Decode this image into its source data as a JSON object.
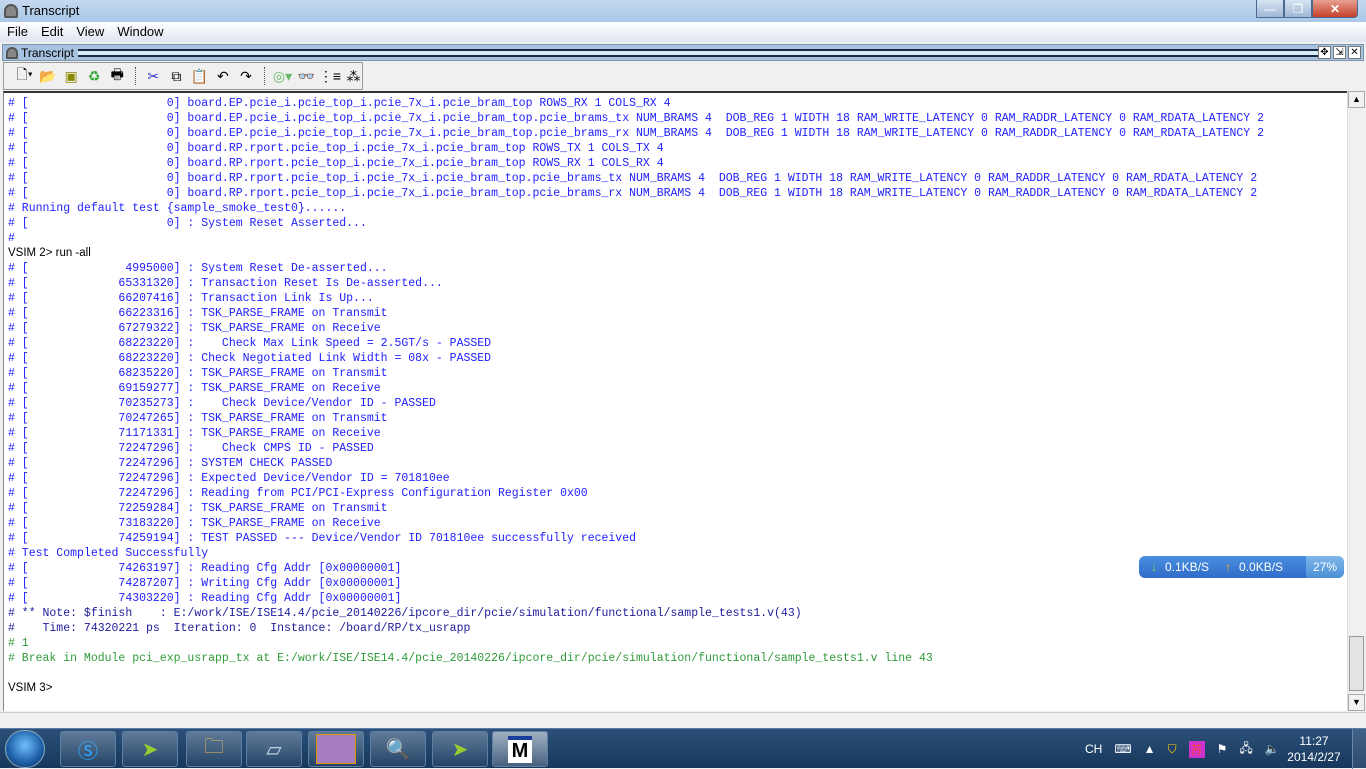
{
  "window": {
    "title": "Transcript",
    "controls": {
      "minimize": "—",
      "maximize": "❐",
      "close": "✕"
    }
  },
  "menu": [
    "File",
    "Edit",
    "View",
    "Window"
  ],
  "panel": {
    "title": "Transcript",
    "buttons": [
      "✥",
      "⇲",
      "✕"
    ]
  },
  "toolbar": {
    "icons": [
      "new-file-icon",
      "open-folder-icon",
      "save-icon",
      "refresh-icon",
      "print-icon",
      "cut-icon",
      "copy-icon",
      "paste-icon",
      "undo-icon",
      "redo-icon",
      "compile-icon",
      "find-icon",
      "collapse-icon",
      "expand-icon"
    ]
  },
  "transcript": {
    "lines": [
      {
        "t": "# [                    0] board.EP.pcie_i.pcie_top_i.pcie_7x_i.pcie_bram_top ROWS_RX 1 COLS_RX 4",
        "c": "blue"
      },
      {
        "t": "# [                    0] board.EP.pcie_i.pcie_top_i.pcie_7x_i.pcie_bram_top.pcie_brams_tx NUM_BRAMS 4  DOB_REG 1 WIDTH 18 RAM_WRITE_LATENCY 0 RAM_RADDR_LATENCY 0 RAM_RDATA_LATENCY 2",
        "c": "blue"
      },
      {
        "t": "# [                    0] board.EP.pcie_i.pcie_top_i.pcie_7x_i.pcie_bram_top.pcie_brams_rx NUM_BRAMS 4  DOB_REG 1 WIDTH 18 RAM_WRITE_LATENCY 0 RAM_RADDR_LATENCY 0 RAM_RDATA_LATENCY 2",
        "c": "blue"
      },
      {
        "t": "# [                    0] board.RP.rport.pcie_top_i.pcie_7x_i.pcie_bram_top ROWS_TX 1 COLS_TX 4",
        "c": "blue"
      },
      {
        "t": "# [                    0] board.RP.rport.pcie_top_i.pcie_7x_i.pcie_bram_top ROWS_RX 1 COLS_RX 4",
        "c": "blue"
      },
      {
        "t": "# [                    0] board.RP.rport.pcie_top_i.pcie_7x_i.pcie_bram_top.pcie_brams_tx NUM_BRAMS 4  DOB_REG 1 WIDTH 18 RAM_WRITE_LATENCY 0 RAM_RADDR_LATENCY 0 RAM_RDATA_LATENCY 2",
        "c": "blue"
      },
      {
        "t": "# [                    0] board.RP.rport.pcie_top_i.pcie_7x_i.pcie_bram_top.pcie_brams_rx NUM_BRAMS 4  DOB_REG 1 WIDTH 18 RAM_WRITE_LATENCY 0 RAM_RADDR_LATENCY 0 RAM_RDATA_LATENCY 2",
        "c": "blue"
      },
      {
        "t": "# Running default test {sample_smoke_test0}......",
        "c": "blue"
      },
      {
        "t": "# [                    0] : System Reset Asserted...",
        "c": "blue"
      },
      {
        "t": "#",
        "c": "blue"
      },
      {
        "t": "VSIM 2> run -all",
        "c": "black"
      },
      {
        "t": "# [              4995000] : System Reset De-asserted...",
        "c": "blue"
      },
      {
        "t": "# [             65331320] : Transaction Reset Is De-asserted...",
        "c": "blue"
      },
      {
        "t": "# [             66207416] : Transaction Link Is Up...",
        "c": "blue"
      },
      {
        "t": "# [             66223316] : TSK_PARSE_FRAME on Transmit",
        "c": "blue"
      },
      {
        "t": "# [             67279322] : TSK_PARSE_FRAME on Receive",
        "c": "blue"
      },
      {
        "t": "# [             68223220] :    Check Max Link Speed = 2.5GT/s - PASSED",
        "c": "blue"
      },
      {
        "t": "# [             68223220] : Check Negotiated Link Width = 08x - PASSED",
        "c": "blue"
      },
      {
        "t": "# [             68235220] : TSK_PARSE_FRAME on Transmit",
        "c": "blue"
      },
      {
        "t": "# [             69159277] : TSK_PARSE_FRAME on Receive",
        "c": "blue"
      },
      {
        "t": "# [             70235273] :    Check Device/Vendor ID - PASSED",
        "c": "blue"
      },
      {
        "t": "# [             70247265] : TSK_PARSE_FRAME on Transmit",
        "c": "blue"
      },
      {
        "t": "# [             71171331] : TSK_PARSE_FRAME on Receive",
        "c": "blue"
      },
      {
        "t": "# [             72247296] :    Check CMPS ID - PASSED",
        "c": "blue"
      },
      {
        "t": "# [             72247296] : SYSTEM CHECK PASSED",
        "c": "blue"
      },
      {
        "t": "# [             72247296] : Expected Device/Vendor ID = 701810ee",
        "c": "blue"
      },
      {
        "t": "# [             72247296] : Reading from PCI/PCI-Express Configuration Register 0x00",
        "c": "blue"
      },
      {
        "t": "# [             72259284] : TSK_PARSE_FRAME on Transmit",
        "c": "blue"
      },
      {
        "t": "# [             73183220] : TSK_PARSE_FRAME on Receive",
        "c": "blue"
      },
      {
        "t": "# [             74259194] : TEST PASSED --- Device/Vendor ID 701810ee successfully received",
        "c": "blue"
      },
      {
        "t": "# Test Completed Successfully",
        "c": "blue"
      },
      {
        "t": "# [             74263197] : Reading Cfg Addr [0x00000001]",
        "c": "blue"
      },
      {
        "t": "# [             74287207] : Writing Cfg Addr [0x00000001]",
        "c": "blue"
      },
      {
        "t": "# [             74303220] : Reading Cfg Addr [0x00000001]",
        "c": "blue"
      },
      {
        "t": "# ** Note: $finish    : E:/work/ISE/ISE14.4/pcie_20140226/ipcore_dir/pcie/simulation/functional/sample_tests1.v(43)",
        "c": "navy"
      },
      {
        "t": "#    Time: 74320221 ps  Iteration: 0  Instance: /board/RP/tx_usrapp",
        "c": "navy"
      },
      {
        "t": "# 1",
        "c": "green"
      },
      {
        "t": "# Break in Module pci_exp_usrapp_tx at E:/work/ISE/ISE14.4/pcie_20140226/ipcore_dir/pcie/simulation/functional/sample_tests1.v line 43",
        "c": "green"
      },
      {
        "t": "",
        "c": "black"
      },
      {
        "t": "VSIM 3>",
        "c": "black"
      }
    ]
  },
  "network_widget": {
    "down": "0.1KB/S",
    "up": "0.0KB/S",
    "cpu": "27%",
    "down_color": "#7ee04a",
    "up_color": "#ffb000"
  },
  "taskbar": {
    "apps": [
      "sogou-icon",
      "xilinx-ise-icon",
      "folder-icon",
      "notepad-icon",
      "image-icon",
      "search-icon",
      "xilinx-impact-icon",
      "modelsim-icon"
    ],
    "active": 7
  },
  "tray": {
    "lang": "CH",
    "time": "11:27",
    "date": "2014/2/27"
  },
  "colors": {
    "blue": "#2020ff",
    "navy": "#1c1c9a",
    "green": "#2f9a3a",
    "black": "#000000"
  }
}
